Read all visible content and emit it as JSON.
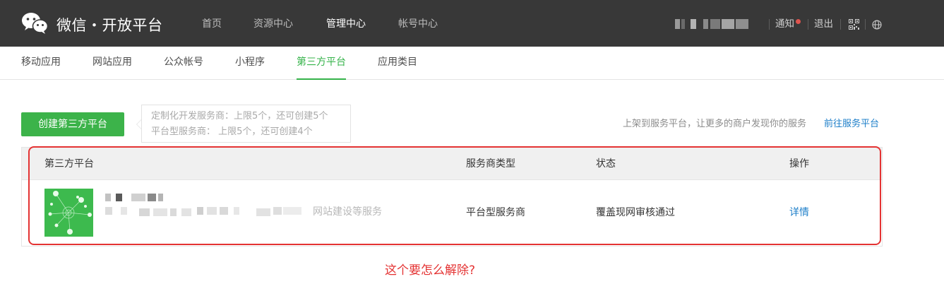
{
  "header": {
    "brand": "微信・开放平台",
    "nav": [
      "首页",
      "资源中心",
      "管理中心",
      "帐号中心"
    ],
    "active_nav": "管理中心",
    "notice": "通知",
    "logout": "退出",
    "icons": [
      "wechat-logo-icon",
      "notification-dot",
      "qrcode-icon",
      "globe-icon"
    ],
    "colors": {
      "bar": "#383838",
      "notice_dot": "#e0544e"
    }
  },
  "subnav": {
    "tabs": [
      "移动应用",
      "网站应用",
      "公众帐号",
      "小程序",
      "第三方平台",
      "应用类目"
    ],
    "active": "第三方平台",
    "accent": "#35b34a"
  },
  "toolbar": {
    "create_label": "创建第三方平台",
    "quota_line1": "定制化开发服务商：上限5个，还可创建5个",
    "quota_line2": "平台型服务商：  上限5个，还可创建4个",
    "promo_text": "上架到服务平台，让更多的商户发现你的服务",
    "promo_link": "前往服务平台"
  },
  "table": {
    "headers": [
      "第三方平台",
      "服务商类型",
      "状态",
      "操作"
    ],
    "rows": [
      {
        "desc_tail": "网站建设等服务",
        "type": "平台型服务商",
        "status": "覆盖现网审核通过",
        "action": "详情"
      }
    ]
  },
  "annotation": {
    "question": "这个要怎么解除?",
    "color": "#e43333"
  }
}
